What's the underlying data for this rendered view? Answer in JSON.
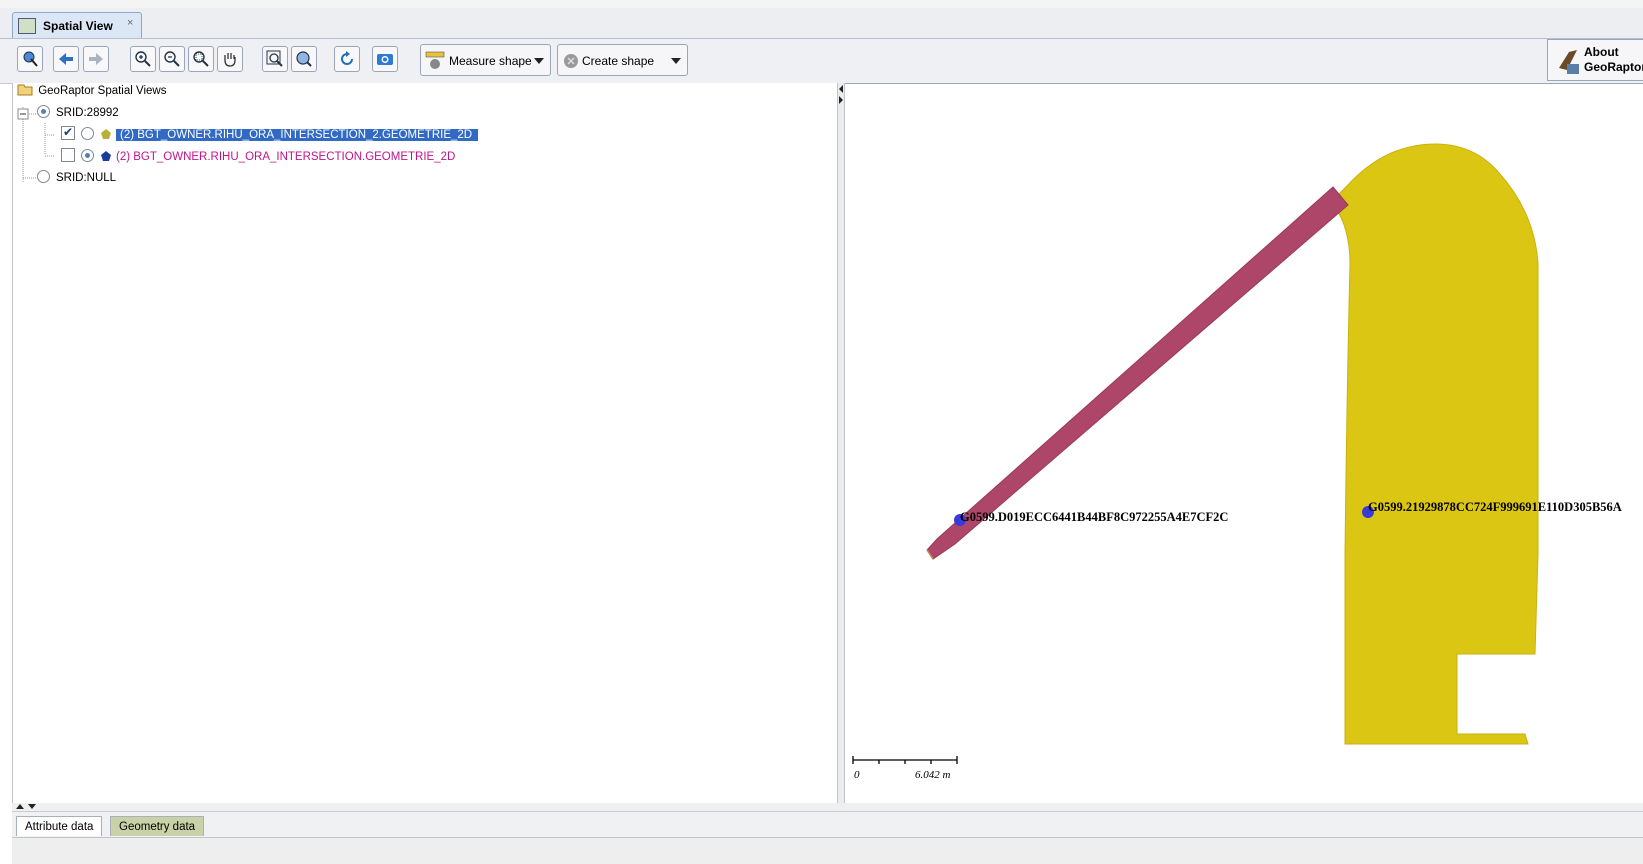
{
  "tab": {
    "title": "Spatial View",
    "close": "×"
  },
  "toolbar": {
    "measure_label": "Measure shape",
    "create_label": "Create shape",
    "about_line1": "About",
    "about_line2": "GeoRaptor"
  },
  "tree": {
    "root_label": "GeoRaptor Spatial Views",
    "srid1_label": "SRID:28992",
    "layer1_label": "(2) BGT_OWNER.RIHU_ORA_INTERSECTION_2.GEOMETRIE_2D",
    "layer2_label": "(2) BGT_OWNER.RIHU_ORA_INTERSECTION.GEOMETRIE_2D",
    "srid2_label": "SRID:NULL"
  },
  "map": {
    "point_label_1": "G0599.D019ECC6441B44BF8C972255A4E7CF2C",
    "point_label_2": "G0599.21929878CC724F999691E110D305B56A",
    "scale_zero": "0",
    "scale_value": "6.042 m",
    "colors": {
      "yellow_polygon": "#dcc614",
      "pink_polygon": "#ad4668",
      "points": "#3a3ad8"
    }
  },
  "bottom": {
    "tab1": "Attribute data",
    "tab2": "Geometry data"
  }
}
